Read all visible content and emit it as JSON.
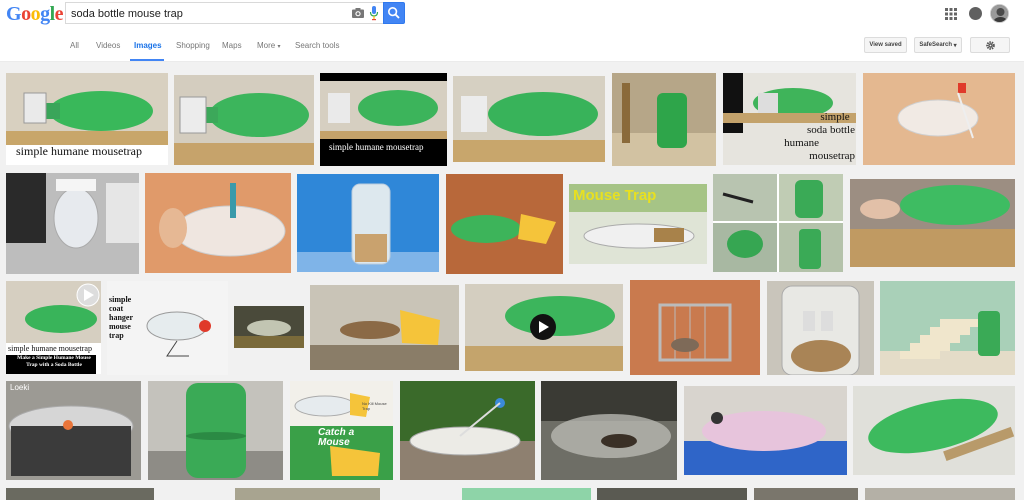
{
  "header": {
    "logo_text": "Google",
    "search_value": "soda bottle mouse trap",
    "colors": {
      "accent": "#4285f4",
      "active_tab": "#1a73e8"
    }
  },
  "nav": {
    "tabs": [
      "All",
      "Videos",
      "Images",
      "Shopping",
      "Maps",
      "More",
      "Search tools"
    ],
    "active": "Images"
  },
  "tools": {
    "view_saved": "View saved",
    "safesearch": "SafeSearch"
  },
  "thumbs": {
    "t1_caption": "simple  humane  mousetrap",
    "t3_caption": "simple  humane  mousetrap",
    "t6_caption_lines": [
      "simple",
      "soda  bottle",
      "humane",
      "mousetrap"
    ],
    "t10_title": "Mouse Trap",
    "t14_caption_lines": [
      "simple",
      "coat",
      "hanger",
      "mouse",
      "trap"
    ],
    "t13_caption": "simple  humane  mousetrap",
    "t13_subcaption": "Make a Simple Humane Mouse Trap with a Soda Bottle",
    "t22_caption_lines": [
      "Catch",
      "a",
      "Mouse"
    ],
    "t22_small": "No Kill Mouse Trap",
    "t19_label": "Loeki"
  }
}
